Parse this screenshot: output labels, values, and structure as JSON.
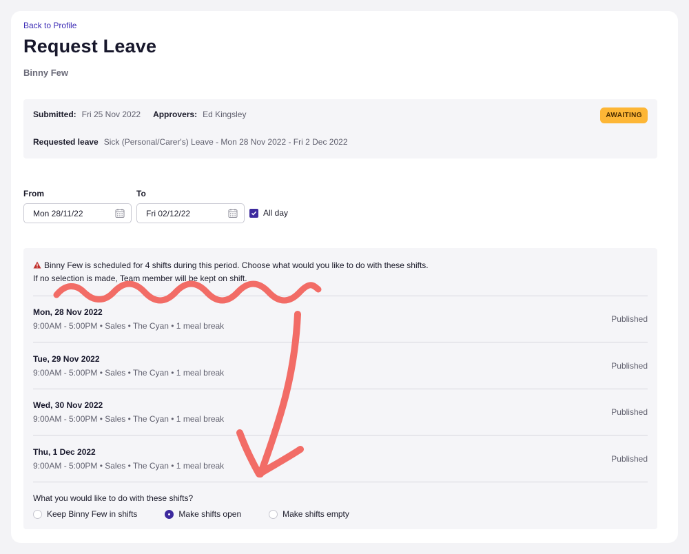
{
  "nav": {
    "back_label": "Back to Profile"
  },
  "page": {
    "title": "Request Leave",
    "employee_name": "Binny Few"
  },
  "summary": {
    "submitted_label": "Submitted:",
    "submitted_value": "Fri 25 Nov 2022",
    "approvers_label": "Approvers:",
    "approvers_value": "Ed Kingsley",
    "requested_label": "Requested leave",
    "requested_value": "Sick (Personal/Carer's) Leave - Mon 28 Nov 2022 - Fri 2 Dec 2022",
    "status_badge": "AWAITING",
    "badge_color": "#fdb636"
  },
  "form": {
    "from_label": "From",
    "from_value": "Mon 28/11/22",
    "to_label": "To",
    "to_value": "Fri 02/12/22",
    "allday_label": "All day",
    "allday_checked": true
  },
  "shifts": {
    "warning_line1": "Binny Few is scheduled for 4 shifts during this period. Choose what would you like to do with these shifts.",
    "warning_line2": "If no selection is made, Team member will be kept on shift.",
    "items": [
      {
        "date": "Mon, 28 Nov 2022",
        "detail": "9:00AM - 5:00PM • Sales • The Cyan • 1 meal break",
        "status": "Published"
      },
      {
        "date": "Tue, 29 Nov 2022",
        "detail": "9:00AM - 5:00PM • Sales • The Cyan • 1 meal break",
        "status": "Published"
      },
      {
        "date": "Wed, 30 Nov 2022",
        "detail": "9:00AM - 5:00PM • Sales • The Cyan • 1 meal break",
        "status": "Published"
      },
      {
        "date": "Thu, 1 Dec 2022",
        "detail": "9:00AM - 5:00PM • Sales • The Cyan • 1 meal break",
        "status": "Published"
      }
    ],
    "question": "What you would like to do with these shifts?",
    "options": [
      {
        "label": "Keep Binny Few in shifts",
        "selected": false
      },
      {
        "label": "Make shifts open",
        "selected": true
      },
      {
        "label": "Make shifts empty",
        "selected": false
      }
    ]
  },
  "colors": {
    "accent": "#3d2a9e",
    "annotation": "#f26c66"
  }
}
